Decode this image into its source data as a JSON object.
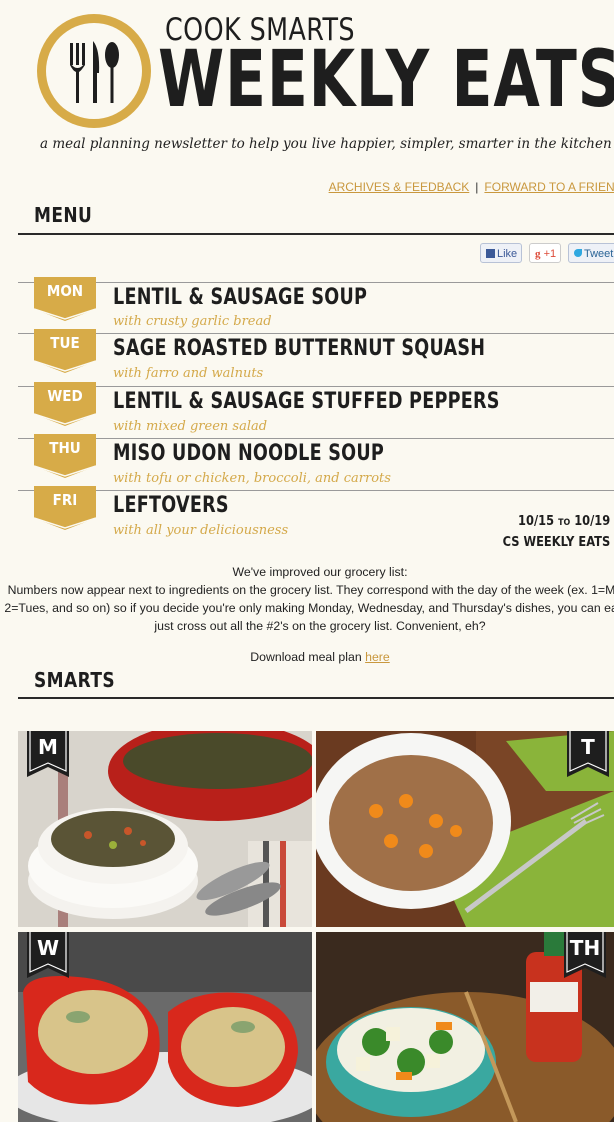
{
  "header": {
    "brand_small": "COOK SMARTS",
    "brand_large": "WEEKLY EATS",
    "tagline": "a meal planning newsletter to help you live happier, simpler, smarter in the kitchen",
    "links": [
      {
        "label": "ARCHIVES & FEEDBACK"
      },
      {
        "label": "FORWARD TO A FRIENI"
      }
    ],
    "link_separator": "|"
  },
  "menu_section": {
    "title": "MENU",
    "social": {
      "like": "Like",
      "gplus": "+1",
      "gplus_icon": "g",
      "tweet": "Tweet"
    },
    "days": [
      {
        "day": "MON",
        "dish": "LENTIL & SAUSAGE SOUP",
        "side": "with crusty garlic bread"
      },
      {
        "day": "TUE",
        "dish": "SAGE ROASTED BUTTERNUT SQUASH",
        "side": "with farro and walnuts"
      },
      {
        "day": "WED",
        "dish": "LENTIL & SAUSAGE STUFFED PEPPERS",
        "side": "with mixed green salad"
      },
      {
        "day": "THU",
        "dish": "MISO UDON NOODLE SOUP",
        "side": "with tofu or chicken, broccoli, and carrots"
      },
      {
        "day": "FRI",
        "dish": "LEFTOVERS",
        "side": "with all your deliciousness"
      }
    ],
    "date_range": {
      "start": "10/15",
      "to": "TO",
      "end": "10/19",
      "subtitle": "CS WEEKLY EATS"
    }
  },
  "notice": {
    "heading": "We've improved our grocery list:",
    "body": "Numbers now appear next to ingredients on the grocery list. They correspond with the day of the week (ex. 1=Mon; 2=Tues, and so on) so if you decide you're only making Monday, Wednesday, and Thursday's dishes, you can easily just cross out all the #2's on the grocery list. Convenient, eh?",
    "download_text": "Download meal plan",
    "download_link": "here"
  },
  "smarts_section": {
    "title": "SMARTS",
    "photos": [
      {
        "tag": "M"
      },
      {
        "tag": "T"
      },
      {
        "tag": "W"
      },
      {
        "tag": "TH"
      }
    ]
  },
  "colors": {
    "gold": "#d7ab48",
    "dark": "#1e1e1e",
    "background": "#fbf9f1",
    "link": "#c9983e"
  },
  "icons": [
    "fork-knife-spoon-icon",
    "facebook-like-icon",
    "google-plus-icon",
    "twitter-bird-icon"
  ]
}
